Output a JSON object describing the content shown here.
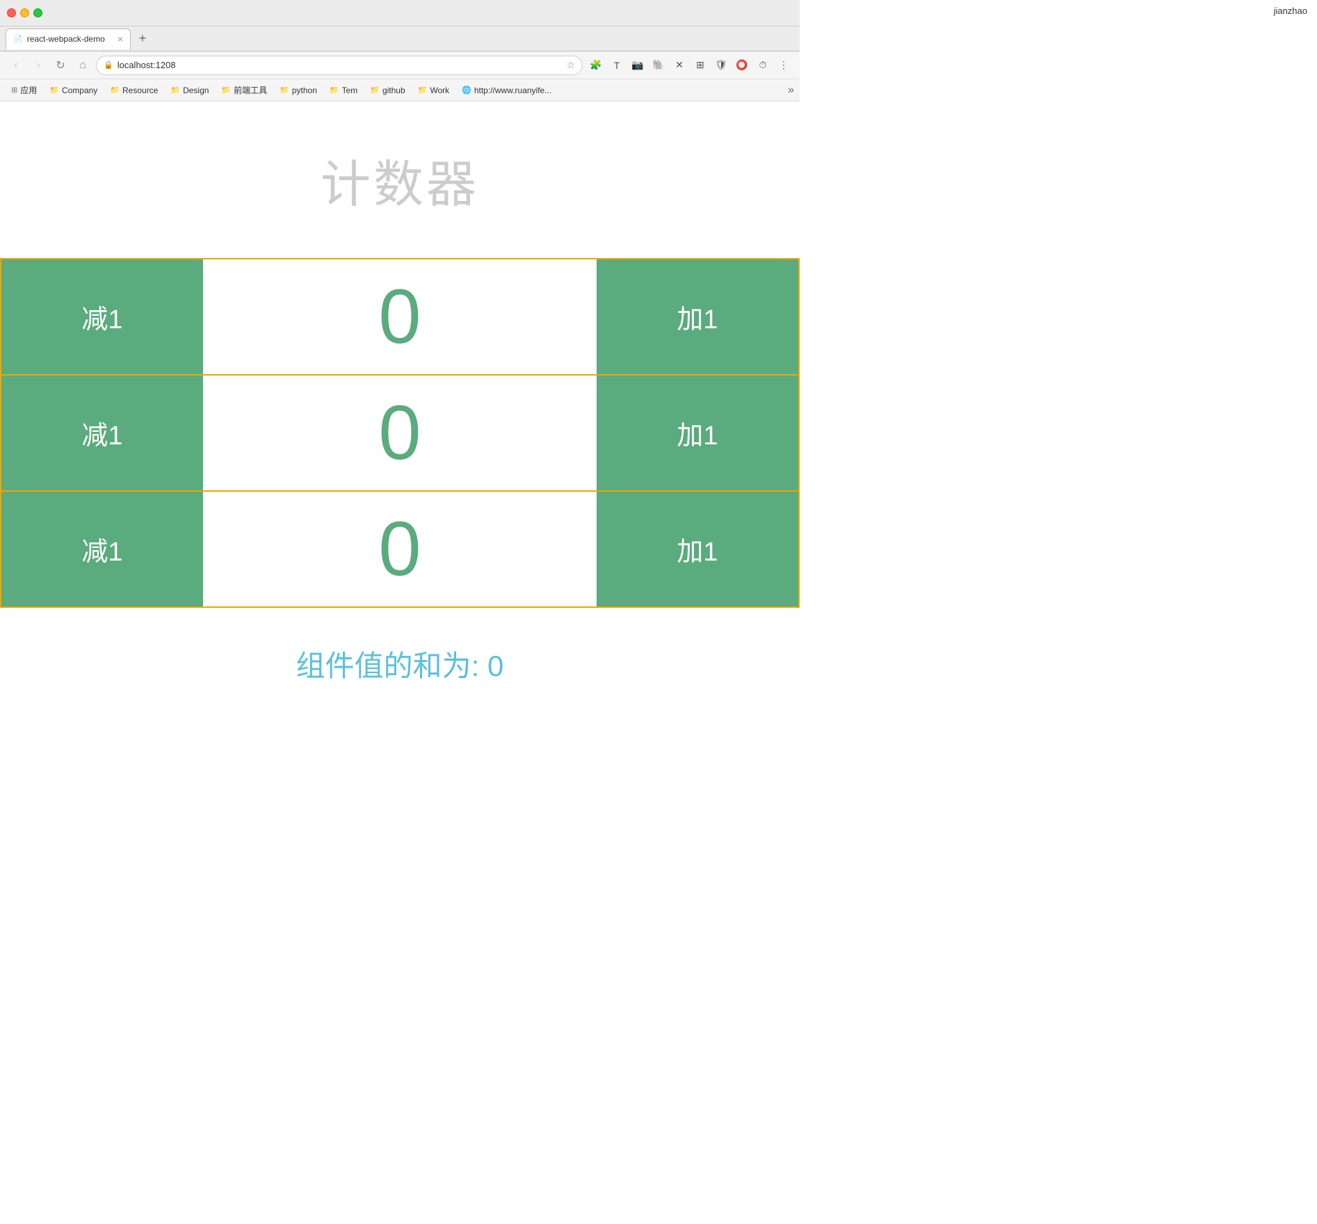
{
  "titleBar": {
    "trafficLights": [
      "red",
      "yellow",
      "green"
    ]
  },
  "tab": {
    "favicon": "📄",
    "title": "react-webpack-demo",
    "closeIcon": "×"
  },
  "addressBar": {
    "url": "localhost:1208",
    "starIcon": "★",
    "lockIcon": "🔒"
  },
  "bookmarks": {
    "items": [
      {
        "icon": "⊞",
        "label": "应用"
      },
      {
        "icon": "📁",
        "label": "Company"
      },
      {
        "icon": "📁",
        "label": "Resource"
      },
      {
        "icon": "📁",
        "label": "Design"
      },
      {
        "icon": "📁",
        "label": "前端工具"
      },
      {
        "icon": "📁",
        "label": "python"
      },
      {
        "icon": "📁",
        "label": "Tem"
      },
      {
        "icon": "📁",
        "label": "github"
      },
      {
        "icon": "📁",
        "label": "Work"
      },
      {
        "icon": "🌐",
        "label": "http://www.ruanyife..."
      }
    ]
  },
  "page": {
    "title": "计数器",
    "counters": [
      {
        "id": 1,
        "value": "0"
      },
      {
        "id": 2,
        "value": "0"
      },
      {
        "id": 3,
        "value": "0"
      }
    ],
    "decrementLabel": "减1",
    "incrementLabel": "加1",
    "sumLabel": "组件值的和为: 0"
  },
  "user": {
    "name": "jianzhao"
  }
}
